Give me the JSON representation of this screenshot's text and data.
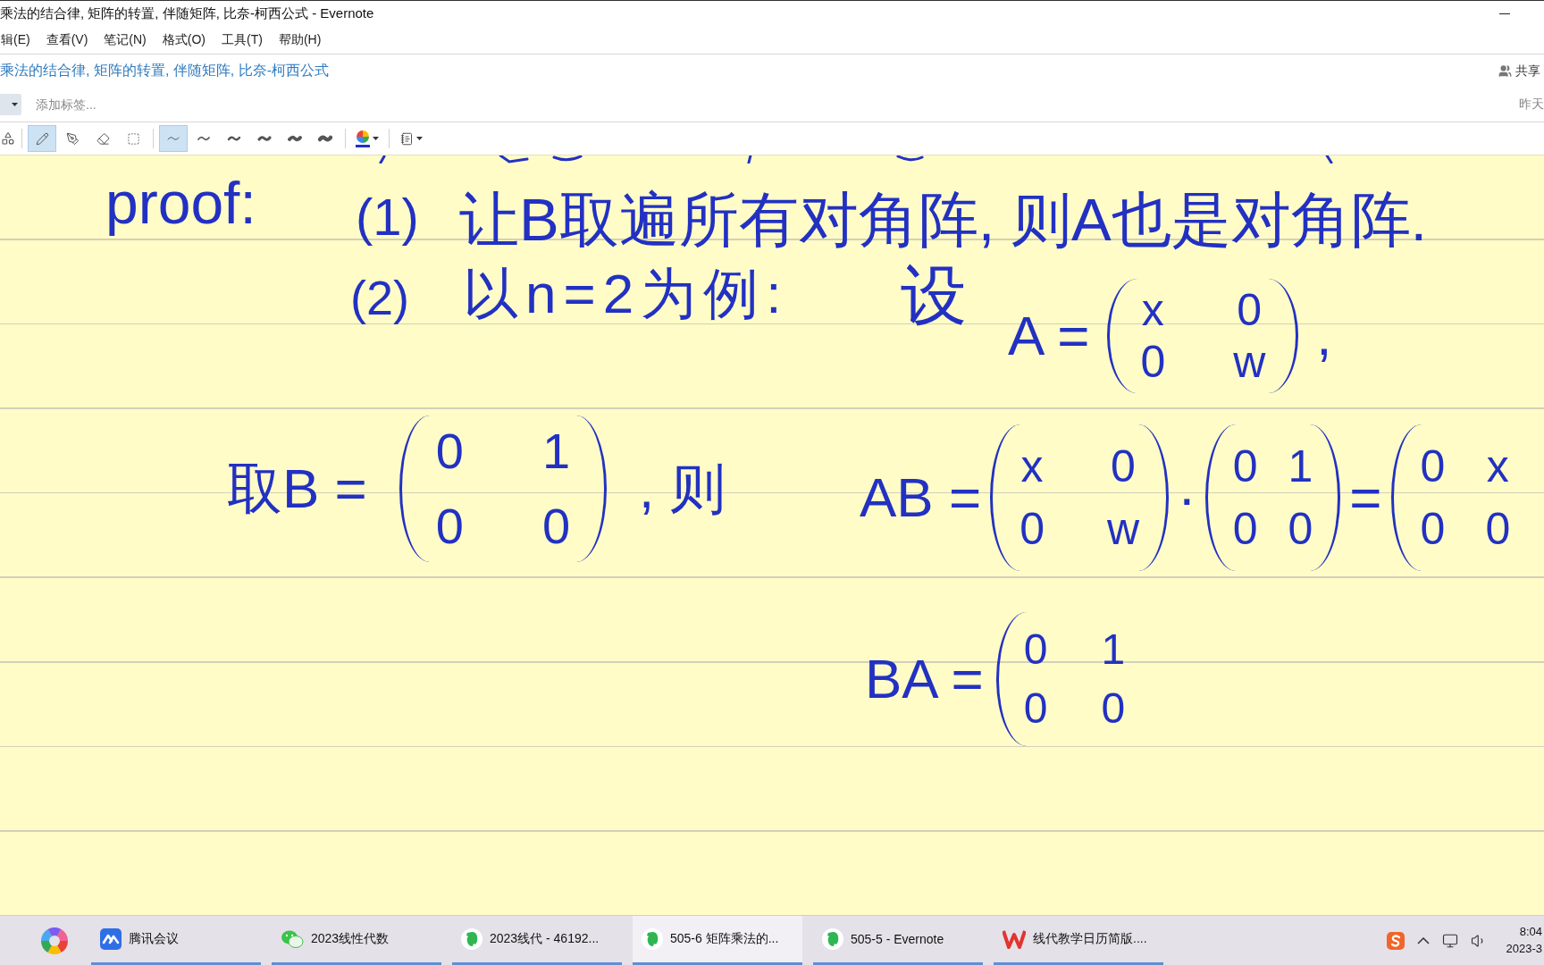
{
  "window": {
    "title": "乘法的结合律, 矩阵的转置, 伴随矩阵, 比奈-柯西公式 - Evernote"
  },
  "menu": [
    {
      "label": "辑(E)"
    },
    {
      "label": "查看(V)"
    },
    {
      "label": "笔记(N)"
    },
    {
      "label": "格式(O)"
    },
    {
      "label": "工具(T)"
    },
    {
      "label": "帮助(H)"
    }
  ],
  "note": {
    "title": "乘法的结合律, 矩阵的转置, 伴随矩阵, 比奈-柯西公式",
    "share_label": "共享",
    "tags_placeholder": "添加标签...",
    "updated": "昨天"
  },
  "ink_toolbar": {
    "tools": [
      {
        "kind": "shapes",
        "selected": false
      },
      {
        "kind": "pencil",
        "selected": true
      },
      {
        "kind": "pen",
        "selected": false
      },
      {
        "kind": "eraser",
        "selected": false
      },
      {
        "kind": "select",
        "selected": false
      }
    ],
    "stroke_widths": [
      {
        "selected": true
      },
      {
        "selected": false
      },
      {
        "selected": false
      },
      {
        "selected": false
      },
      {
        "selected": false
      },
      {
        "selected": false
      }
    ],
    "color_picker": {
      "color": "#2231c2"
    }
  },
  "ink": {
    "groups": [
      {
        "parts": [
          {
            "kind": "text",
            "text": "proof:"
          }
        ]
      },
      {
        "parts": [
          {
            "kind": "text",
            "text": "(1)"
          }
        ]
      },
      {
        "parts": [
          {
            "kind": "text",
            "text": "让B取遍所有对角阵, 则A也是对角阵."
          }
        ]
      },
      {
        "parts": [
          {
            "kind": "text",
            "text": "(2)"
          }
        ]
      },
      {
        "parts": [
          {
            "kind": "text",
            "text": "以n=2为例:"
          }
        ]
      },
      {
        "parts": [
          {
            "kind": "text",
            "text": "设"
          }
        ]
      },
      {
        "parts": [
          {
            "kind": "text",
            "text": "A ="
          },
          {
            "kind": "matrix",
            "rows": [
              [
                "x",
                "0"
              ],
              [
                "0",
                "w"
              ]
            ],
            "closed": true
          },
          {
            "kind": "text",
            "text": ","
          }
        ]
      },
      {
        "parts": [
          {
            "kind": "text",
            "text": "取B ="
          },
          {
            "kind": "matrix",
            "rows": [
              [
                "0",
                "1"
              ],
              [
                "0",
                "0"
              ]
            ],
            "closed": true
          },
          {
            "kind": "text",
            "text": ", 则"
          }
        ]
      },
      {
        "parts": [
          {
            "kind": "text",
            "text": "AB ="
          },
          {
            "kind": "matrix",
            "rows": [
              [
                "x",
                "0"
              ],
              [
                "0",
                "w"
              ]
            ],
            "closed": true
          },
          {
            "kind": "text",
            "text": "·"
          },
          {
            "kind": "matrix",
            "rows": [
              [
                "0",
                "1"
              ],
              [
                "0",
                "0"
              ]
            ],
            "closed": true
          },
          {
            "kind": "text",
            "text": "="
          },
          {
            "kind": "matrix",
            "rows": [
              [
                "0",
                "x"
              ],
              [
                "0",
                "0"
              ]
            ],
            "closed": false
          }
        ]
      },
      {
        "parts": [
          {
            "kind": "text",
            "text": "BA ="
          },
          {
            "kind": "matrix",
            "rows": [
              [
                "0",
                "1"
              ],
              [
                "0",
                "0"
              ]
            ],
            "closed": false
          }
        ]
      }
    ]
  },
  "taskbar": {
    "pinned": [
      {
        "kind": "color-wheel"
      }
    ],
    "apps": [
      {
        "kind": "meeting",
        "label": "腾讯会议",
        "selected": false
      },
      {
        "kind": "wechat",
        "label": "2023线性代数",
        "selected": false
      },
      {
        "kind": "evernote",
        "label": "2023线代 - 46192...",
        "selected": false
      },
      {
        "kind": "evernote",
        "label": "505-6 矩阵乘法的...",
        "selected": true
      },
      {
        "kind": "evernote",
        "label": "505-5 - Evernote",
        "selected": false
      },
      {
        "kind": "wps",
        "label": "线代教学日历简版....",
        "selected": false
      }
    ],
    "time": "8:04",
    "date": "2023-3"
  }
}
